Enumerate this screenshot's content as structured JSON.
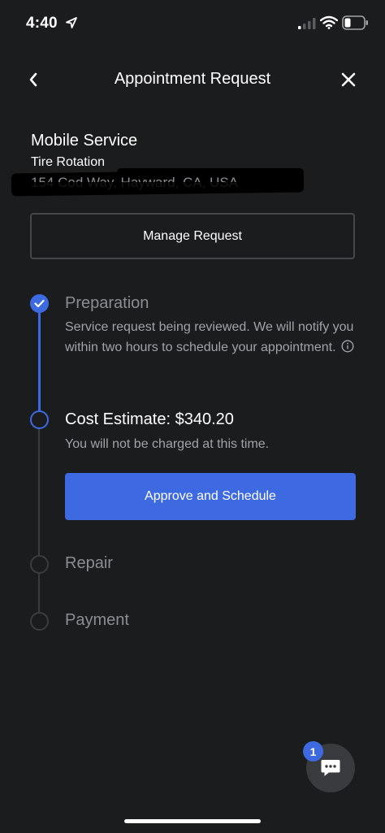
{
  "status_bar": {
    "time": "4:40",
    "icons": [
      "location-arrow-icon",
      "cellular-signal-icon",
      "wifi-icon",
      "battery-icon"
    ]
  },
  "header": {
    "title": "Appointment Request",
    "back_icon": "chevron-left-icon",
    "close_icon": "close-icon"
  },
  "service": {
    "type": "Mobile Service",
    "name": "Tire Rotation",
    "address": "154 Cod Way, Hayward, CA, USA"
  },
  "manage_button": {
    "label": "Manage Request"
  },
  "steps": [
    {
      "title": "Preparation",
      "status": "completed",
      "description": "Service request being reviewed. We will notify you within two hours to schedule your appointment."
    },
    {
      "title": "Cost Estimate: $340.20",
      "status": "current",
      "description": "You will not be charged at this time."
    },
    {
      "title": "Repair",
      "status": "upcoming"
    },
    {
      "title": "Payment",
      "status": "upcoming"
    }
  ],
  "approve_button": {
    "label": "Approve and Schedule"
  },
  "chat": {
    "badge_count": "1",
    "icon": "chat-bubble-icon"
  },
  "colors": {
    "background": "#1b1c1e",
    "accent": "#3e6ae1",
    "muted_text": "#8a8d91",
    "button_border": "#45474b"
  }
}
